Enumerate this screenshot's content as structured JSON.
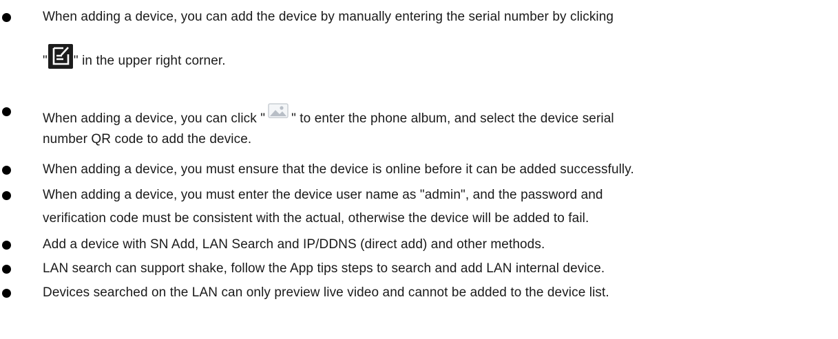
{
  "items": [
    {
      "line1": "When adding a device, you can add the device by manually entering the serial number by clicking",
      "line2_before": "\"",
      "line2_icon": "edit-icon",
      "line2_after": "\" in the upper right corner."
    },
    {
      "line1_before": "When adding a device, you can click \"",
      "line1_icon": "image-album-icon",
      "line1_after": "\" to enter the phone album, and select the device serial",
      "line2": "number QR code to add the device."
    },
    {
      "line1": "When adding a device, you must ensure that the device is online before it can be added successfully."
    },
    {
      "line1": "When adding a device, you must enter the device user name as \"admin\", and the password and",
      "line2": "verification code must be consistent with the actual, otherwise the device will be added to fail."
    },
    {
      "line1": "Add a device with SN Add, LAN Search and IP/DDNS (direct add) and other methods."
    },
    {
      "line1": "LAN search can support shake, follow the App tips steps to search and add LAN internal device."
    },
    {
      "line1": "Devices searched on the LAN can only preview live video and cannot be added to the device list."
    }
  ]
}
